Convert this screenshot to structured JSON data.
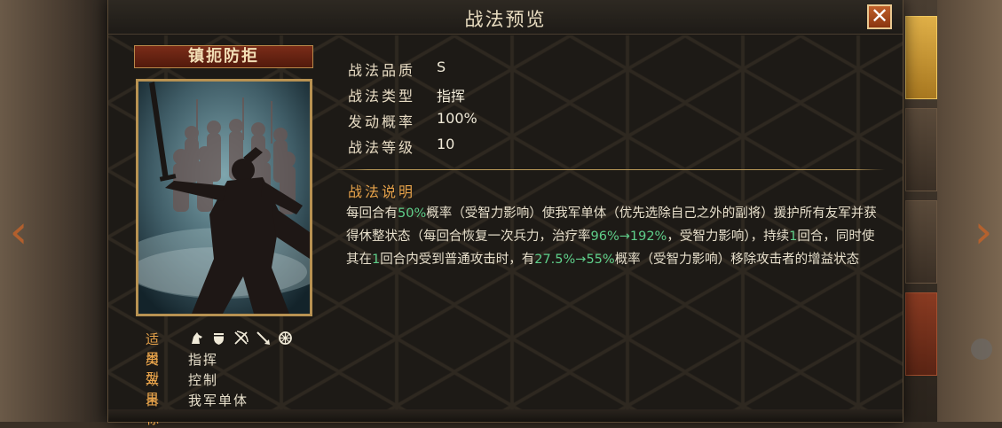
{
  "dialog": {
    "title": "战法预览",
    "close_label": "✕"
  },
  "tactic": {
    "name": "镇扼防拒"
  },
  "attributes": {
    "applicable": {
      "label": "适用",
      "icons": [
        "cavalry-icon",
        "shield-icon",
        "archer-icon",
        "spear-icon",
        "chariot-icon"
      ]
    },
    "type": {
      "label": "类型",
      "value": "指挥"
    },
    "effect": {
      "label": "效果",
      "value": "控制"
    },
    "target": {
      "label": "目标",
      "value": "我军单体"
    }
  },
  "stats": {
    "quality": {
      "label": "战法品质",
      "value": "S"
    },
    "kind": {
      "label": "战法类型",
      "value": "指挥"
    },
    "trigger_rate": {
      "label": "发动概率",
      "value": "100%"
    },
    "level": {
      "label": "战法等级",
      "value": "10"
    }
  },
  "description": {
    "title": "战法说明",
    "segments": [
      {
        "text": "每回合有",
        "highlight": false
      },
      {
        "text": "50%",
        "highlight": true
      },
      {
        "text": "概率（受智力影响）使我军单体（优先选除自己之外的副将）援护所有友军并获得休整状态（每回合恢复一次兵力，治疗率",
        "highlight": false
      },
      {
        "text": "96%→192%",
        "highlight": true
      },
      {
        "text": "，受智力影响），持续",
        "highlight": false
      },
      {
        "text": "1",
        "highlight": true
      },
      {
        "text": "回合，同时使其在",
        "highlight": false
      },
      {
        "text": "1",
        "highlight": true
      },
      {
        "text": "回合内受到普通攻击时，有",
        "highlight": false
      },
      {
        "text": "27.5%→55%",
        "highlight": true
      },
      {
        "text": "概率（受智力影响）移除攻击者的增益状态",
        "highlight": false
      }
    ]
  },
  "colors": {
    "label_orange": "#e6a24a",
    "highlight_green": "#5fcf8a",
    "plate_red": "#7a2c18",
    "frame_gold": "#b89252"
  }
}
